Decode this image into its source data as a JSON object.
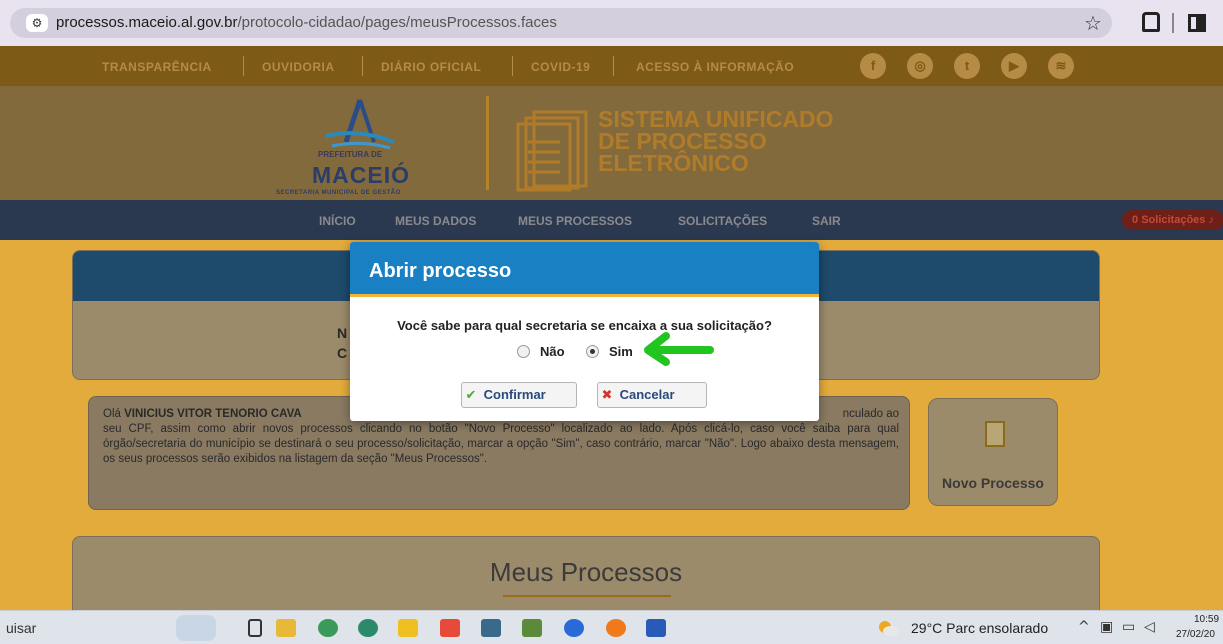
{
  "browser": {
    "url_host": "processos.maceio.al.gov.br",
    "url_path": "/protocolo-cidadao/pages/meusProcessos.faces"
  },
  "topnav": {
    "links": [
      "TRANSPARÊNCIA",
      "OUVIDORIA",
      "DIÁRIO OFICIAL",
      "COVID-19",
      "ACESSO À INFORMAÇÃO"
    ],
    "social": [
      "facebook-icon",
      "instagram-icon",
      "twitter-icon",
      "youtube-icon",
      "spotify-icon"
    ]
  },
  "header": {
    "logo_sub1": "PREFEITURA DE",
    "logo_main": "MACEIÓ",
    "logo_sub2": "SECRETARIA MUNICIPAL DE GESTÃO",
    "system_title": [
      "SISTEMA UNIFICADO",
      "DE PROCESSO",
      "ELETRÔNICO"
    ]
  },
  "mainnav": {
    "items": [
      "INÍCIO",
      "MEUS DADOS",
      "MEUS PROCESSOS",
      "SOLICITAÇÕES",
      "SAIR"
    ],
    "solicitacoes_badge": "0 Solicitações"
  },
  "panel1": {
    "line1": "N",
    "line2": "C"
  },
  "welcome": {
    "name": "VINICIUS VITOR TENORIO CAVA",
    "greeting": "Olá",
    "tail": "nculado ao",
    "text": "seu CPF, assim como abrir novos processos clicando no botão \"Novo Processo\" localizado ao lado. Após clicá-lo, caso você saiba para qual órgão/secretaria do município se destinará o seu processo/solicitação, marcar a opção \"Sim\", caso contrário, marcar \"Não\". Logo abaixo desta mensagem, os seus processos serão exibidos na listagem da seção \"Meus Processos\"."
  },
  "novo_processo": {
    "label": "Novo Processo"
  },
  "meus_processos": {
    "title": "Meus Processos"
  },
  "modal": {
    "title": "Abrir processo",
    "question": "Você sabe para qual secretaria se encaixa a sua solicitação?",
    "option_no": "Não",
    "option_yes": "Sim",
    "selected": "Sim",
    "confirm_label": "Confirmar",
    "cancel_label": "Cancelar"
  },
  "taskbar": {
    "search": "uisar",
    "weather": "29°C  Parc ensolarado",
    "time": "10:59",
    "date": "27/02/20"
  },
  "colors": {
    "accent": "#1a80c4",
    "page_bg_dimmed": "#e3ab3b",
    "annotation_arrow": "#22c51f"
  }
}
